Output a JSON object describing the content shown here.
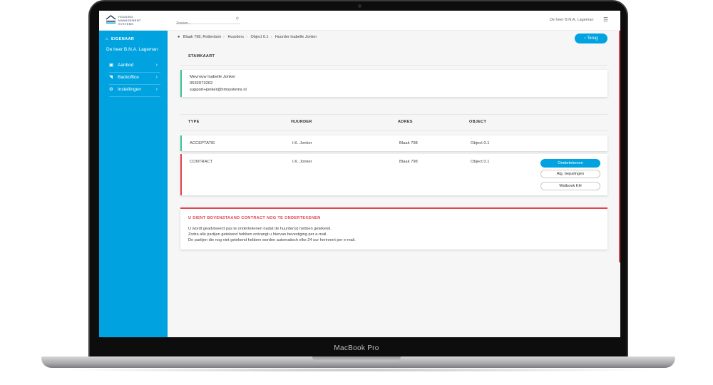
{
  "device": {
    "label": "MacBook Pro"
  },
  "brand": {
    "logo_lines": [
      "HOUSING",
      "MANAGEMENT",
      "SYSTEMS"
    ]
  },
  "search": {
    "placeholder": "Zoeken..."
  },
  "header": {
    "user_name": "De heer B.N.A. Lageman"
  },
  "sidebar": {
    "role": "EIGENAAR",
    "owner_name": "De heer B.N.A. Lageman",
    "items": [
      {
        "label": "Aanbod",
        "icon": "cart-icon"
      },
      {
        "label": "Backoffice",
        "icon": "folder-icon"
      },
      {
        "label": "Instellingen",
        "icon": "gear-icon"
      }
    ]
  },
  "breadcrumb": [
    "Blaak 798, Rotterdam",
    "Huurders",
    "Object 0.1",
    "Huurder Isabelle Jonker"
  ],
  "back_button": "Terug",
  "stamkaart": {
    "title": "STAMKAART",
    "name": "Mevrouw Isabelle Jonker",
    "phone": "0532073202",
    "email": "support+jonker@hmsystems.nl"
  },
  "table": {
    "headers": {
      "type": "TYPE",
      "tenant": "HUURDER",
      "address": "ADRES",
      "object": "OBJECT"
    },
    "rows": [
      {
        "type": "ACCEPTATIE",
        "tenant": "I.K. Jonker",
        "address": "Blaak 798",
        "object": "Object 0.1"
      },
      {
        "type": "CONTRACT",
        "tenant": "I.K. Jonker",
        "address": "Blaak 798",
        "object": "Object 0.1"
      }
    ],
    "actions": [
      "Ondertekenen",
      "Alg. bepalingen",
      "Wetboek KH"
    ]
  },
  "notice": {
    "title": "U DIENT BOVENSTAAND CONTRACT NOG TE ONDERTEKENEN",
    "lines": [
      "U wordt geadviseerd pas te ondertekenen nadat de huurder(s) hebben getekend.",
      "Zodra alle partijen getekend hebben ontvangt u hiervan bevestiging per e-mail.",
      "De partijen die nog niet getekend hebben worden automatisch elke 24 uur herinnert per e-mail."
    ]
  },
  "colors": {
    "accent": "#00a3e0",
    "success": "#3cc29b",
    "danger": "#e2434d"
  }
}
